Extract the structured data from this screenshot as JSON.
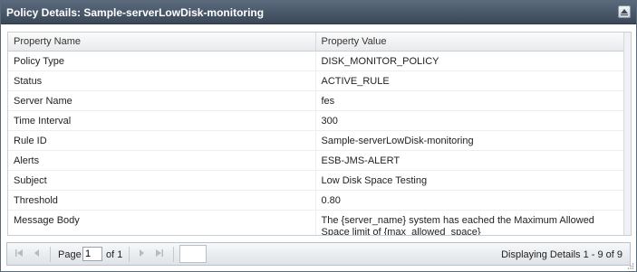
{
  "panel": {
    "title": "Policy Details: Sample-serverLowDisk-monitoring"
  },
  "grid": {
    "columns": [
      "Property Name",
      "Property Value"
    ],
    "rows": [
      {
        "name": "Policy Type",
        "value": "DISK_MONITOR_POLICY"
      },
      {
        "name": "Status",
        "value": "ACTIVE_RULE"
      },
      {
        "name": "Server Name",
        "value": "fes"
      },
      {
        "name": "Time Interval",
        "value": "300"
      },
      {
        "name": "Rule ID",
        "value": "Sample-serverLowDisk-monitoring"
      },
      {
        "name": "Alerts",
        "value": "ESB-JMS-ALERT"
      },
      {
        "name": "Subject",
        "value": "Low Disk Space Testing"
      },
      {
        "name": "Threshold",
        "value": "0.80"
      },
      {
        "name": "Message Body",
        "value": "The {server_name} system has eached the Maximum Allowed Space limit of {max_allowed_space}"
      }
    ]
  },
  "pager": {
    "page_label": "Page",
    "page_value": "1",
    "of_label": "of 1",
    "display_info": "Displaying Details 1 - 9 of 9"
  },
  "icons": {
    "collapse": "collapse-up-icon",
    "first": "first-page-icon",
    "prev": "prev-page-icon",
    "next": "next-page-icon",
    "last": "last-page-icon"
  },
  "colors": {
    "titlebar": "#4a5868",
    "title_text": "#ffffff"
  }
}
